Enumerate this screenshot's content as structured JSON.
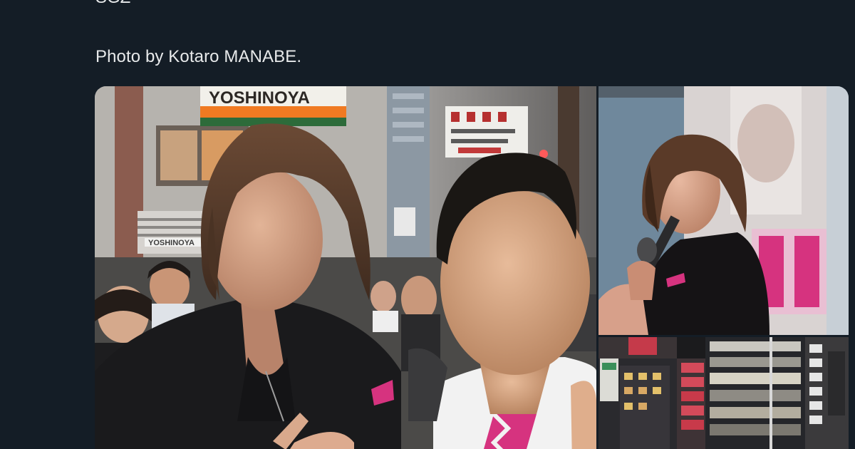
{
  "tweet": {
    "clipped_text": "SGZ",
    "credit_text": "Photo by Kotaro MANABE."
  },
  "media": {
    "photos": [
      {
        "name": "main-photo",
        "sign_text": "YOSHINOYA",
        "lower_sign_text": "YOSHINOYA"
      },
      {
        "name": "speech-photo"
      },
      {
        "name": "night-street-photo"
      }
    ]
  },
  "colors": {
    "background": "#141d26",
    "text": "#e7e9ea",
    "accent_pink": "#d6337f"
  }
}
